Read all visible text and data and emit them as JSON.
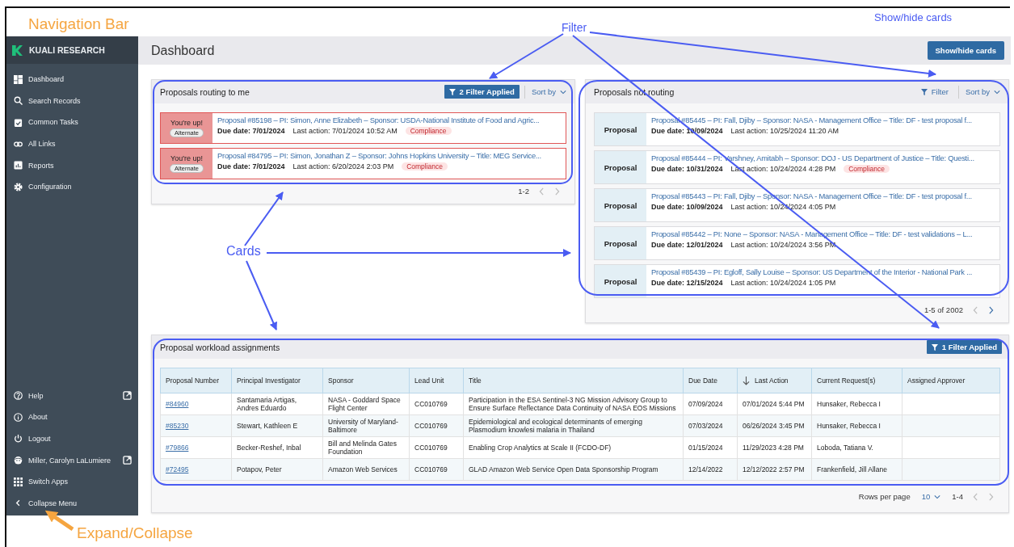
{
  "annotations": [
    {
      "kind": "orange",
      "text": "Navigation Bar"
    },
    {
      "kind": "blue",
      "text": "Filter"
    },
    {
      "kind": "blue",
      "text": "Show/hide cards"
    },
    {
      "kind": "blue",
      "text": "Cards"
    },
    {
      "kind": "orange",
      "text": "Expand/Collapse"
    }
  ],
  "sidebar": {
    "brand": "KUALI RESEARCH",
    "top_items": [
      {
        "label": "Dashboard"
      },
      {
        "label": "Search Records"
      },
      {
        "label": "Common Tasks"
      },
      {
        "label": "All Links"
      },
      {
        "label": "Reports"
      },
      {
        "label": "Configuration"
      }
    ],
    "bottom_items": [
      {
        "label": "Help",
        "external": true
      },
      {
        "label": "About",
        "external": false
      },
      {
        "label": "Logout",
        "external": false
      },
      {
        "label": "Miller, Carolyn LaLumiere",
        "external": true
      },
      {
        "label": "Switch Apps",
        "external": false
      },
      {
        "label": "Collapse Menu",
        "external": false
      }
    ]
  },
  "header": {
    "title": "Dashboard",
    "button": "Show/hide cards"
  },
  "routing_panel": {
    "title": "Proposals routing to me",
    "filter": {
      "label": "2 Filter Applied",
      "active": true
    },
    "sort": "Sort by",
    "pagination": "1-2",
    "cards": [
      {
        "status": "You're up!",
        "badge": "Alternate",
        "title": "Proposal #85198 – PI: Simon, Anne Elizabeth – Sponsor: USDA-National Institute of Food and Agric...",
        "due": "Due date: 7/01/2024",
        "last_action": "Last action: 7/01/2024 10:52 AM",
        "tag": "Compliance"
      },
      {
        "status": "You're up!",
        "badge": "Alternate",
        "title": "Proposal #84795 – PI: Simon, Jonathan Z – Sponsor: Johns Hopkins University – Title: MEG Service...",
        "due": "Due date: 7/01/2024",
        "last_action": "Last action: 6/20/2024 2:03 PM",
        "tag": "Compliance"
      }
    ]
  },
  "not_routing_panel": {
    "title": "Proposals not routing",
    "filter": {
      "label": "Filter",
      "active": false
    },
    "sort": "Sort by",
    "pagination": "1-5 of 2002",
    "cards": [
      {
        "label": "Proposal",
        "title": "Proposal #85445 – PI: Fall, Djiby – Sponsor: NASA - Management Office – Title: DF - test proposal f...",
        "due": "Due date: 10/09/2024",
        "last_action": "Last action: 10/25/2024 11:20 AM"
      },
      {
        "label": "Proposal",
        "title": "Proposal #85444 – PI: Varshney, Amitabh – Sponsor: DOJ - US Department of Justice – Title: Questi...",
        "due": "Due date: 10/31/2024",
        "last_action": "Last action: 10/24/2024 4:28 PM",
        "tag": "Compliance"
      },
      {
        "label": "Proposal",
        "title": "Proposal #85443 – PI: Fall, Djiby – Sponsor: NASA - Management Office – Title: DF - test proposal f...",
        "due": "Due date: 10/09/2024",
        "last_action": "Last action: 10/24/2024 4:05 PM"
      },
      {
        "label": "Proposal",
        "title": "Proposal #85442 – PI: None – Sponsor: NASA - Management Office – Title: DF - test validations – L...",
        "due": "Due date: 12/01/2024",
        "last_action": "Last action: 10/24/2024 3:56 PM"
      },
      {
        "label": "Proposal",
        "title": "Proposal #85439 – PI: Egloff, Sally Louise – Sponsor: US Department of the Interior - National Park ...",
        "due": "Due date: 12/15/2024",
        "last_action": "Last action: 10/24/2024 1:05 PM"
      }
    ]
  },
  "workload_panel": {
    "title": "Proposal workload assignments",
    "filter": {
      "label": "1 Filter Applied",
      "active": true
    },
    "table": {
      "columns": [
        {
          "label": "Proposal Number",
          "sorted": false
        },
        {
          "label": "Principal Investigator",
          "sorted": false
        },
        {
          "label": "Sponsor",
          "sorted": false
        },
        {
          "label": "Lead Unit",
          "sorted": false
        },
        {
          "label": "Title",
          "sorted": false
        },
        {
          "label": "Due Date",
          "sorted": false
        },
        {
          "label": "Last Action",
          "sorted": true
        },
        {
          "label": "Current Request(s)",
          "sorted": false
        },
        {
          "label": "Assigned Approver",
          "sorted": false
        }
      ],
      "rows": [
        [
          "#84960",
          "Santamaria Artigas, Andres Eduardo",
          "NASA - Goddard Space Flight Center",
          "CC010769",
          "Participation in the ESA Sentinel-3 NG Mission Advisory Group to Ensure Surface Reflectance Data Continuity of NASA EOS Missions",
          "07/09/2024",
          "07/01/2024 5:44 PM",
          "Hunsaker, Rebecca I",
          ""
        ],
        [
          "#85230",
          "Stewart, Kathleen E",
          "University of Maryland-Baltimore",
          "CC010769",
          "Epidemiological and ecological determinants of emerging Plasmodium knowlesi malaria in Thailand",
          "07/03/2024",
          "06/26/2024 3:45 PM",
          "Hunsaker, Rebecca I",
          ""
        ],
        [
          "#79866",
          "Becker-Reshef, Inbal",
          "Bill and Melinda Gates Foundation",
          "CC010769",
          "Enabling Crop Analytics at Scale II (FCDO-DF)",
          "01/15/2024",
          "11/29/2023 4:28 PM",
          "Loboda, Tatiana V.",
          ""
        ],
        [
          "#72495",
          "Potapov, Peter",
          "Amazon Web Services",
          "CC010769",
          "GLAD Amazon Web Service Open Data Sponsorship Program",
          "12/14/2022",
          "12/12/2022 2:57 PM",
          "Frankenfield, Jill Allane",
          ""
        ]
      ]
    },
    "rows_per_page_label": "Rows per page",
    "rows_per_page": "10",
    "pagination": "1-4"
  }
}
